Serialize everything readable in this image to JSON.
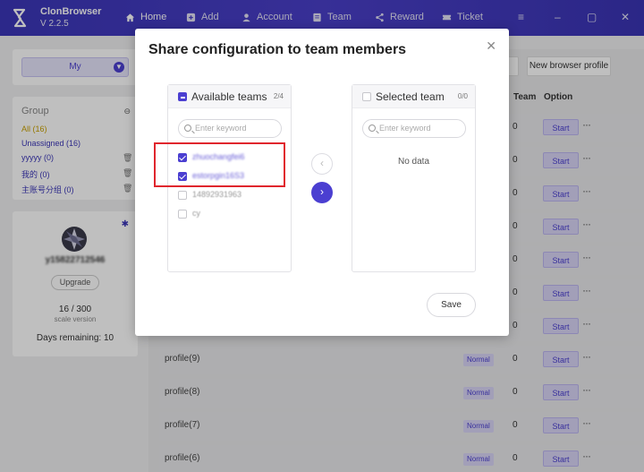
{
  "app": {
    "name": "ClonBrowser",
    "version": "V 2.2.5"
  },
  "nav": {
    "home": "Home",
    "add": "Add",
    "account": "Account",
    "team": "Team",
    "reward": "Reward",
    "ticket": "Ticket"
  },
  "sidebar": {
    "selector": "My",
    "group_title": "Group",
    "groups": [
      {
        "label": "All  (16)"
      },
      {
        "label": "Unassigned  (16)"
      },
      {
        "label": "yyyyy  (0)"
      },
      {
        "label": "我的  (0)"
      },
      {
        "label": "主账号分组  (0)"
      }
    ],
    "user": {
      "username": "y15822712546",
      "upgrade": "Upgrade",
      "count_current": "16",
      "count_sep": " / ",
      "count_max": "300",
      "scale_label": "scale version",
      "days_label": "Days remaining: ",
      "days_value": "10"
    }
  },
  "main": {
    "new_profile_button": "New browser profile",
    "headers": {
      "team": "Team",
      "option": "Option"
    },
    "rows": [
      {
        "name": "",
        "status": "",
        "team": "0",
        "start": "Start"
      },
      {
        "name": "",
        "status": "",
        "team": "0",
        "start": "Start"
      },
      {
        "name": "",
        "status": "",
        "team": "0",
        "start": "Start"
      },
      {
        "name": "",
        "status": "",
        "team": "0",
        "start": "Start"
      },
      {
        "name": "",
        "status": "",
        "team": "0",
        "start": "Start"
      },
      {
        "name": "",
        "status": "",
        "team": "0",
        "start": "Start"
      },
      {
        "name": "",
        "status": "",
        "team": "0",
        "start": "Start"
      },
      {
        "name": "profile(9)",
        "status": "Normal",
        "team": "0",
        "start": "Start"
      },
      {
        "name": "profile(8)",
        "status": "Normal",
        "team": "0",
        "start": "Start"
      },
      {
        "name": "profile(7)",
        "status": "Normal",
        "team": "0",
        "start": "Start"
      },
      {
        "name": "profile(6)",
        "status": "Normal",
        "team": "0",
        "start": "Start"
      }
    ]
  },
  "modal": {
    "title": "Share configuration to team members",
    "available": {
      "label": "Available teams",
      "count": "2/4",
      "search_placeholder": "Enter keyword",
      "teams": [
        {
          "name": "zhuochangfei6",
          "checked": true
        },
        {
          "name": "estorpgin16S3",
          "checked": true
        },
        {
          "name": "14892931963",
          "checked": false
        },
        {
          "name": "cy",
          "checked": false
        }
      ]
    },
    "selected": {
      "label": "Selected team",
      "count": "0/0",
      "search_placeholder": "Enter keyword",
      "empty": "No data"
    },
    "save_button": "Save"
  }
}
